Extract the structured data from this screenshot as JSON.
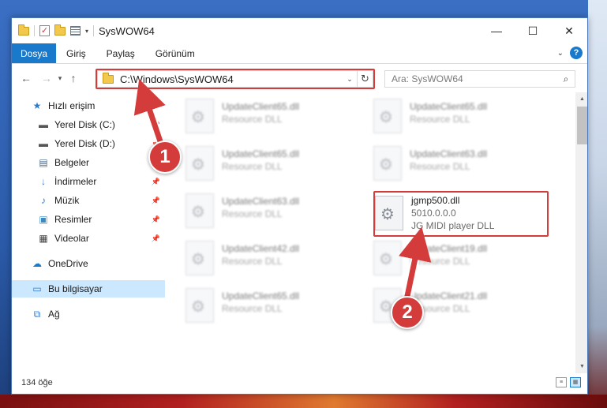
{
  "window": {
    "title": "SysWOW64",
    "controls": {
      "minimize": "—",
      "maximize": "☐",
      "close": "✕"
    }
  },
  "ribbon": {
    "file_tab": "Dosya",
    "tabs": [
      "Giriş",
      "Paylaş",
      "Görünüm"
    ]
  },
  "address": {
    "path": "C:\\Windows\\SysWOW64",
    "search_placeholder": "Ara: SysWOW64"
  },
  "sidebar": {
    "items": [
      {
        "label": "Hızlı erişim",
        "icon": "star-icon",
        "pinned": false
      },
      {
        "label": "Yerel Disk (C:)",
        "icon": "drive-icon",
        "pinned": true
      },
      {
        "label": "Yerel Disk (D:)",
        "icon": "drive-icon",
        "pinned": true
      },
      {
        "label": "Belgeler",
        "icon": "document-icon",
        "pinned": true
      },
      {
        "label": "İndirmeler",
        "icon": "download-icon",
        "pinned": true
      },
      {
        "label": "Müzik",
        "icon": "music-icon",
        "pinned": true
      },
      {
        "label": "Resimler",
        "icon": "pictures-icon",
        "pinned": true
      },
      {
        "label": "Videolar",
        "icon": "video-icon",
        "pinned": true
      },
      {
        "label": "OneDrive",
        "icon": "cloud-icon",
        "pinned": false
      },
      {
        "label": "Bu bilgisayar",
        "icon": "computer-icon",
        "pinned": false,
        "selected": true
      },
      {
        "label": "Ağ",
        "icon": "network-icon",
        "pinned": false
      }
    ]
  },
  "files": [
    {
      "name": "UpdateClient65.dll",
      "sub": "Resource DLL",
      "blurred": true
    },
    {
      "name": "UpdateClient65.dll",
      "sub": "Resource DLL",
      "blurred": true
    },
    {
      "name": "UpdateClient65.dll",
      "sub": "Resource DLL",
      "blurred": true
    },
    {
      "name": "UpdateClient63.dll",
      "sub": "Resource DLL",
      "blurred": true
    },
    {
      "name": "UpdateClient63.dll",
      "sub": "Resource DLL",
      "blurred": true
    },
    {
      "name": "jgmp500.dll",
      "sub": "5010.0.0.0",
      "sub2": "JG MIDI player DLL",
      "blurred": false
    },
    {
      "name": "UpdateClient42.dll",
      "sub": "Resource DLL",
      "blurred": true
    },
    {
      "name": "UpdateClient19.dll",
      "sub": "Resource DLL",
      "blurred": true
    },
    {
      "name": "UpdateClient65.dll",
      "sub": "Resource DLL",
      "blurred": true
    },
    {
      "name": "UpdateClient21.dll",
      "sub": "Resource DLL",
      "blurred": true
    }
  ],
  "status": {
    "count": "134 öğe"
  },
  "annotations": {
    "badge1": "1",
    "badge2": "2",
    "color": "#d43b3b"
  }
}
